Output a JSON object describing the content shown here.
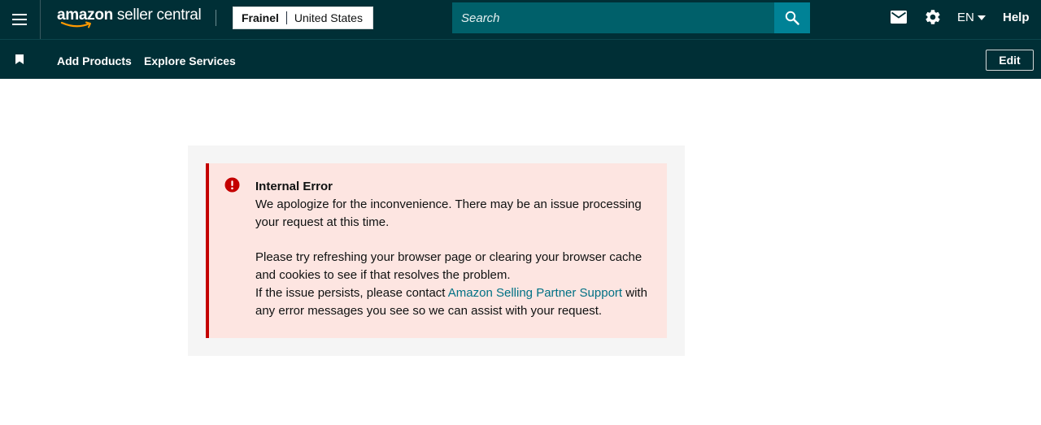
{
  "header": {
    "logo_brand": "amazon",
    "logo_product": " seller central",
    "store_name": "Frainel",
    "marketplace": "United States",
    "search_placeholder": "Search",
    "language": "EN",
    "help_label": "Help"
  },
  "navbar": {
    "items": [
      {
        "label": "Add Products"
      },
      {
        "label": "Explore Services"
      }
    ],
    "edit_label": "Edit"
  },
  "error": {
    "title": "Internal Error",
    "message": "We apologize for the inconvenience. There may be an issue processing your request at this time.",
    "advice": "Please try refreshing your browser page or clearing your browser cache and cookies to see if that resolves the problem.",
    "persist_prefix": "If the issue persists, please contact ",
    "link_text": "Amazon Selling Partner Support",
    "persist_suffix": " with any error messages you see so we can assist with your request."
  },
  "icons": {
    "menu": "hamburger-menu-icon",
    "search": "search-icon",
    "mail": "mail-icon",
    "settings": "gear-icon",
    "language_caret": "caret-down-icon",
    "bookmark": "bookmark-icon",
    "error": "error-alert-icon"
  },
  "colors": {
    "header_bg": "#002f36",
    "search_field_bg": "#00606a",
    "search_button_bg": "#008296",
    "alert_bg": "#fde5e1",
    "alert_border": "#c40000",
    "link": "#007185",
    "panel_bg": "#f5f5f5"
  }
}
